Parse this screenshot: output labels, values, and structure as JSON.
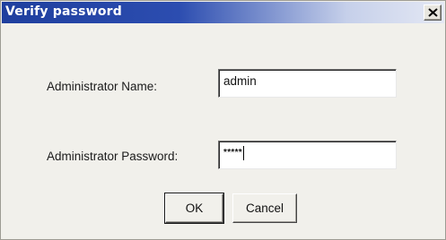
{
  "window": {
    "title": "Verify password",
    "close_glyph": "✕"
  },
  "form": {
    "admin_name_label": "Administrator Name:",
    "admin_name_value": "admin",
    "admin_password_label": "Administrator Password:",
    "admin_password_value": "*****"
  },
  "buttons": {
    "ok_label": "OK",
    "cancel_label": "Cancel"
  },
  "icons": {
    "close": "close-icon"
  }
}
